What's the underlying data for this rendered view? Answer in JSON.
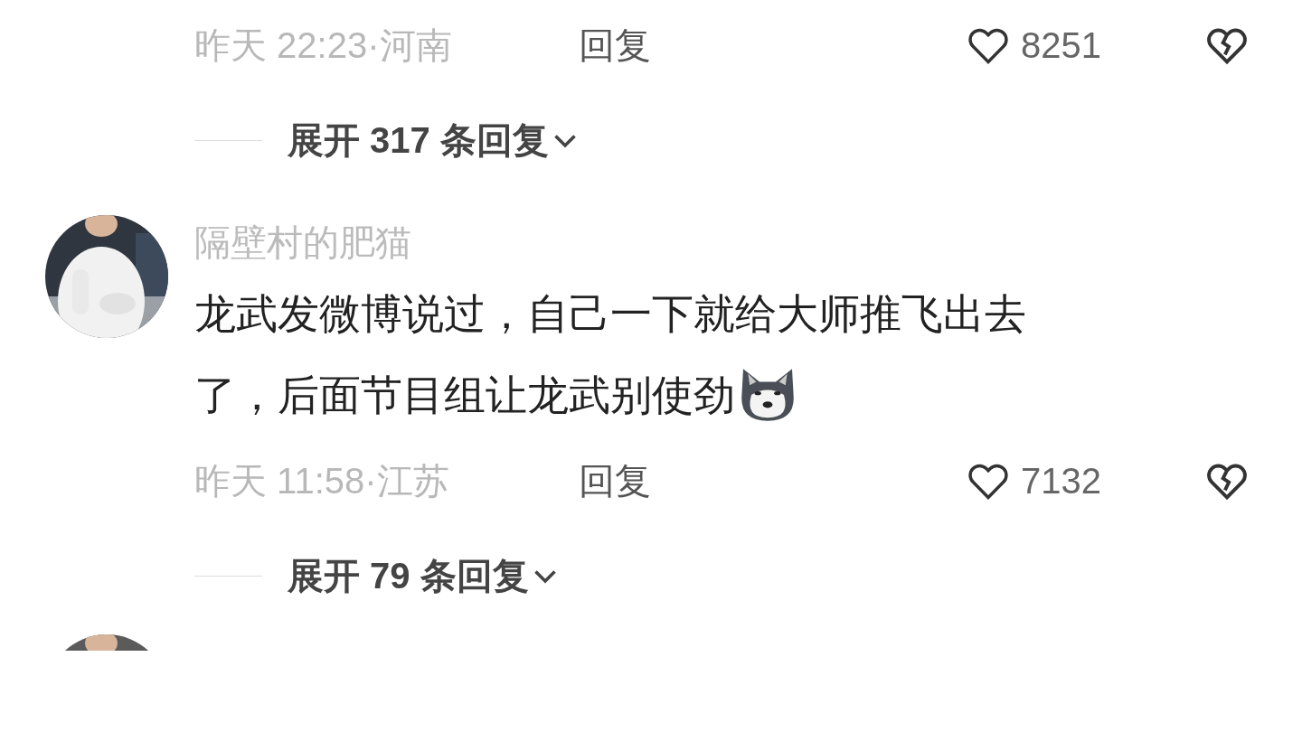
{
  "comments": [
    {
      "time": "昨天 22:23·河南",
      "reply": "回复",
      "likes": "8251",
      "expand": "展开 317 条回复"
    },
    {
      "author": "隔壁村的肥猫",
      "avatar": {
        "kind": "picture"
      },
      "text_lines": [
        "龙武发微博说过，自己一下就给大师推飞出去",
        "了，后面节目组让龙武别使劲"
      ],
      "time": "昨天 11:58·江苏",
      "reply": "回复",
      "likes": "7132",
      "expand": "展开 79 条回复"
    },
    {
      "avatar": {
        "kind": "picture"
      }
    }
  ]
}
